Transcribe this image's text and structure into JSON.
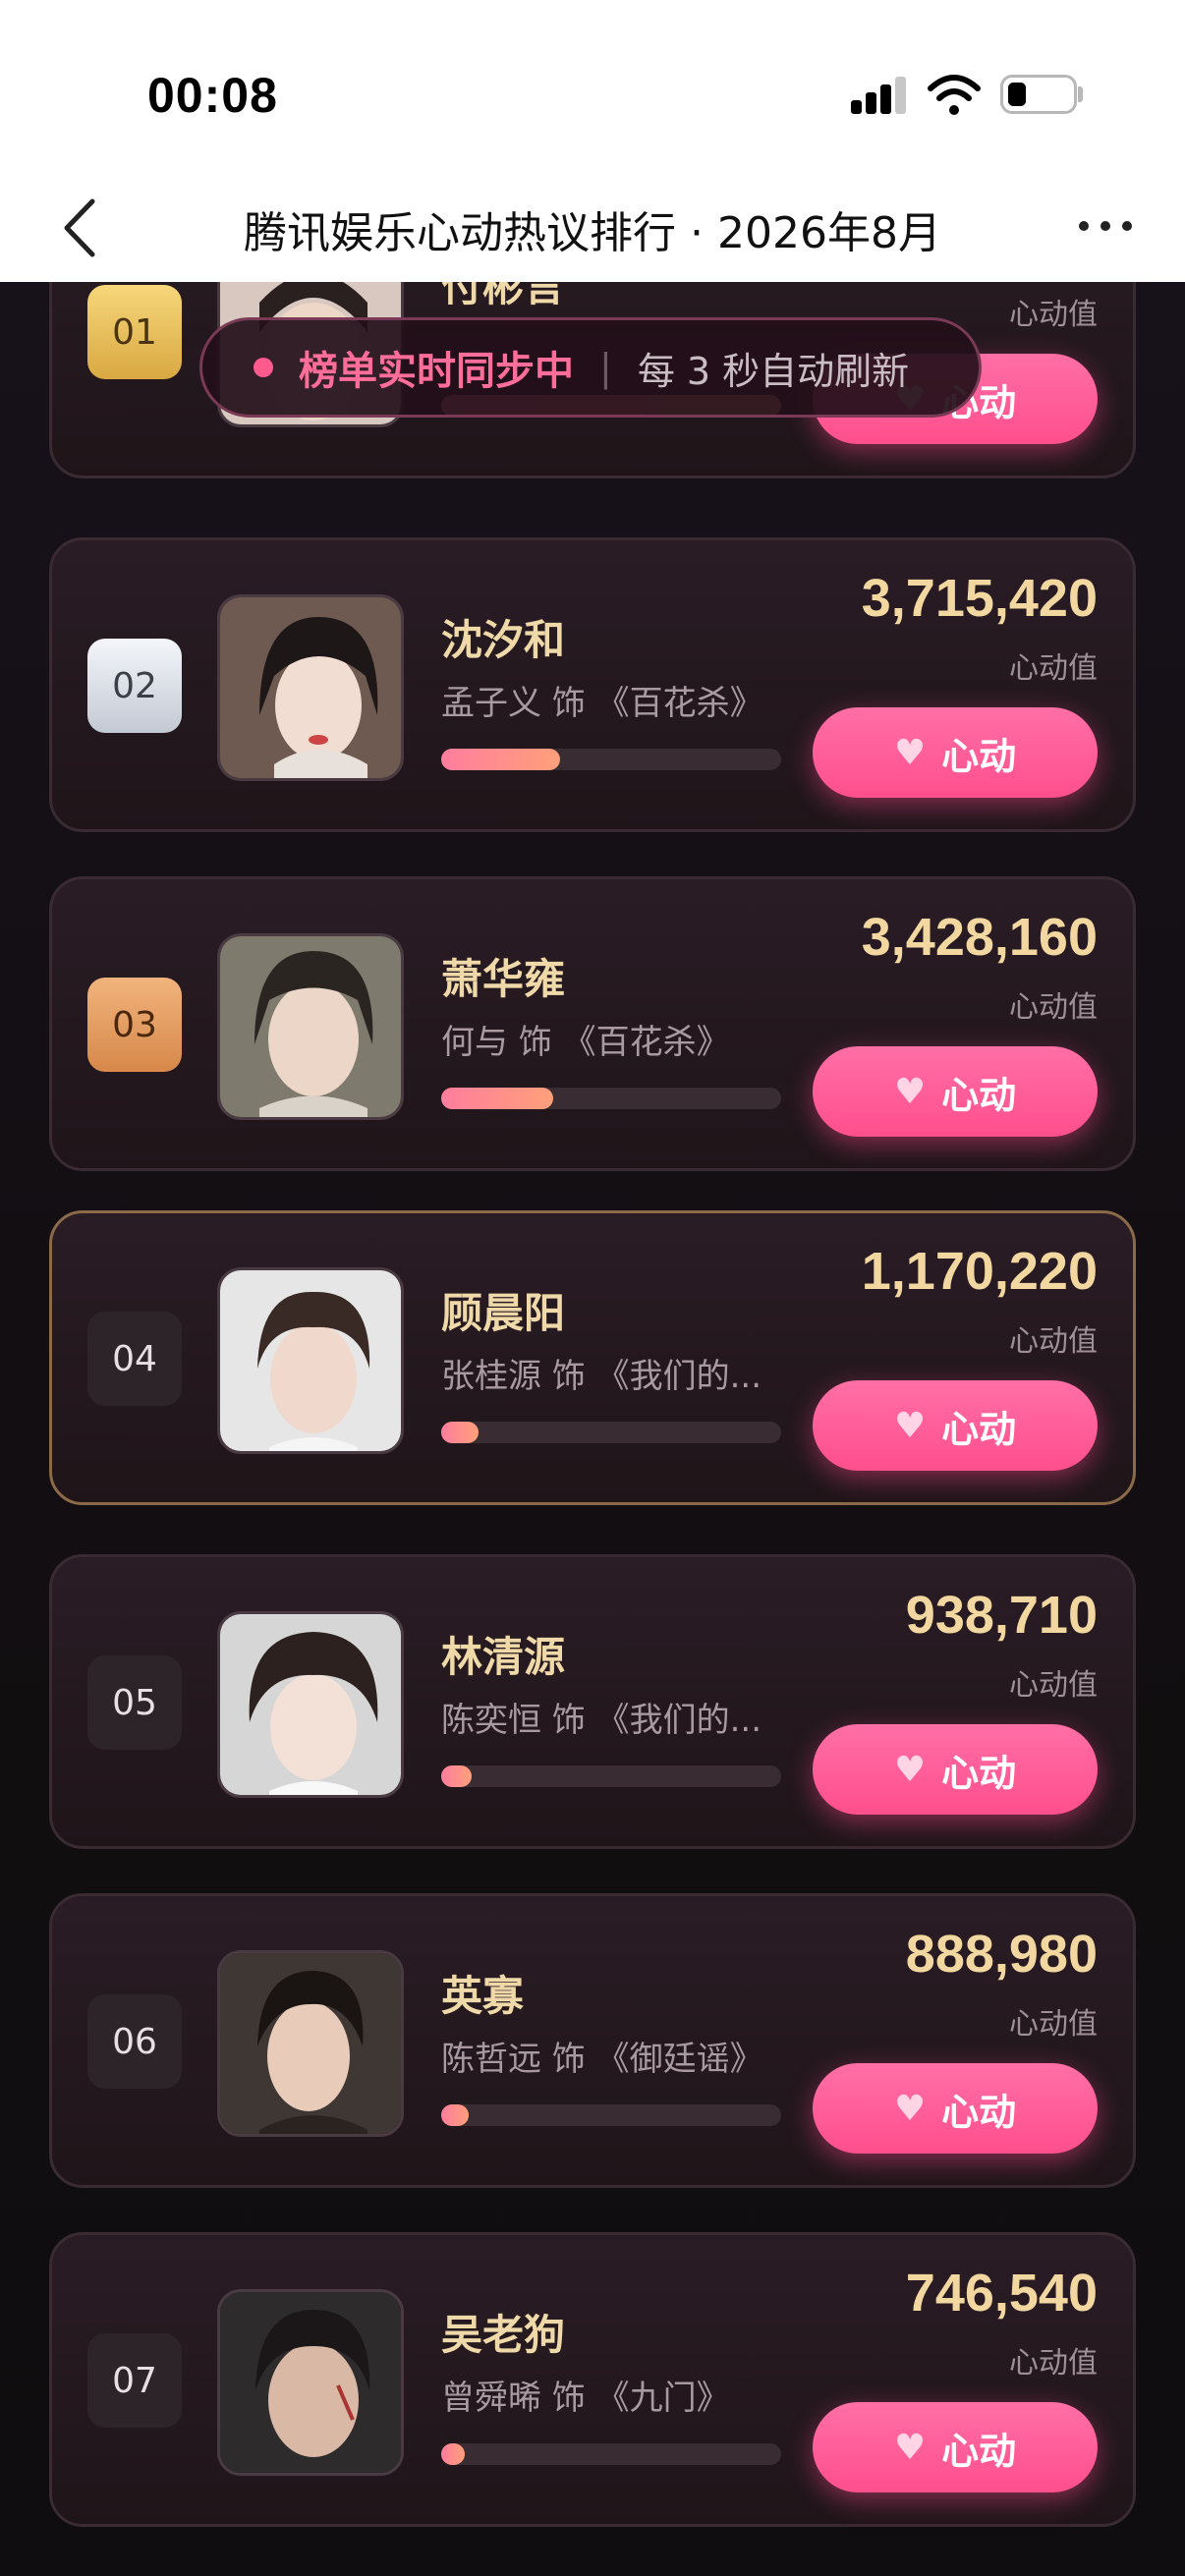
{
  "status_bar": {
    "time": "00:08"
  },
  "nav": {
    "title": "腾讯娱乐心动热议排行 · 2026年8月"
  },
  "toast": {
    "live_text": "榜单实时同步中",
    "separator": "|",
    "refresh_text": "每 3 秒自动刷新"
  },
  "list": {
    "score_label": "心动值",
    "button_label": "心动",
    "items": [
      {
        "rank": "01",
        "name": "付彬言",
        "subtitle": "",
        "score": "",
        "progress": 1.0
      },
      {
        "rank": "02",
        "name": "沈汐和",
        "subtitle": "孟子义 饰 《百花杀》",
        "score": "3,715,420",
        "progress": 0.35
      },
      {
        "rank": "03",
        "name": "萧华雍",
        "subtitle": "何与 饰 《百花杀》",
        "score": "3,428,160",
        "progress": 0.33
      },
      {
        "rank": "04",
        "name": "顾晨阳",
        "subtitle": "张桂源 饰 《我们的...",
        "score": "1,170,220",
        "progress": 0.11
      },
      {
        "rank": "05",
        "name": "林清源",
        "subtitle": "陈奕恒 饰 《我们的...",
        "score": "938,710",
        "progress": 0.09
      },
      {
        "rank": "06",
        "name": "英寡",
        "subtitle": "陈哲远 饰 《御廷谣》",
        "score": "888,980",
        "progress": 0.08
      },
      {
        "rank": "07",
        "name": "吴老狗",
        "subtitle": "曾舜晞 饰 《九门》",
        "score": "746,540",
        "progress": 0.07
      }
    ]
  },
  "colors": {
    "accent_pink": "#ff4f8d",
    "gold_text": "#f2d8a0",
    "card_bg": "#2a1c25",
    "highlight_border": "#8a6a48"
  },
  "icons": {
    "back": "chevron-left-icon",
    "more": "more-dots-icon",
    "heart": "heart-icon",
    "signal": "signal-icon",
    "wifi": "wifi-icon",
    "battery": "battery-icon"
  }
}
